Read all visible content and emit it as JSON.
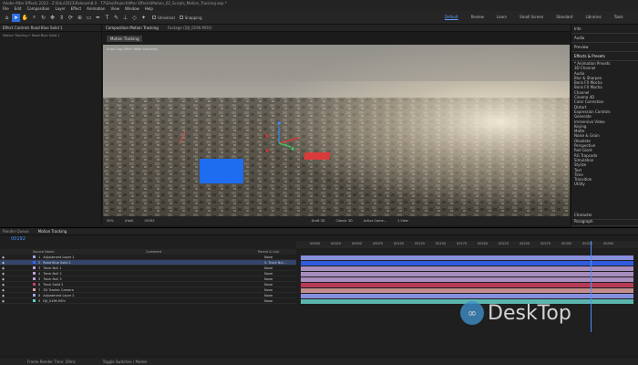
{
  "title_bar": "Adobe After Effects 2023 - Z:\\Edu\\2023\\Release\\8.0 - 77\\Edu\\Project\\After Effects\\Motion_02_Scripts_Motion_Tracking.aep *",
  "menu": [
    "File",
    "Edit",
    "Composition",
    "Layer",
    "Effect",
    "Animation",
    "View",
    "Window",
    "Help"
  ],
  "toolbar": {
    "universal_label": "Universal",
    "snapping_label": "Snapping",
    "workspaces": [
      "Default",
      "Review",
      "Learn",
      "Small Screen",
      "Standard",
      "Libraries",
      "Tools"
    ]
  },
  "project_panel": {
    "tab": "Effect Controls Road Blue Solid 1",
    "subtitle": "Motion Tracking • Road Blue Solid 1"
  },
  "composition": {
    "tab": "Composition Motion Tracking",
    "footage_tab": "Footage (DJI_0196.MOV)",
    "chip": "Motion Tracking",
    "overlay_text": "Auto Crop Effect Wide Smoothly",
    "bottom": {
      "zoom": "50%",
      "res": "(Half)",
      "timecode": "00192",
      "camera": "Classic 3D",
      "active_camera": "Active Came...",
      "views": "1 View",
      "draft": "Draft 3D"
    }
  },
  "right_panel": {
    "sections": [
      "Info",
      "Audio",
      "Preview",
      "Effects & Presets"
    ],
    "effects": [
      "* Animation Presets",
      "3D Channel",
      "Audio",
      "Blur & Sharpen",
      "Boris FX Mocha",
      "Boris FX Mocha",
      "Channel",
      "Cinema 4D",
      "Color Correction",
      "Distort",
      "Expression Controls",
      "Generate",
      "Immersive Video",
      "Keying",
      "Matte",
      "Noise & Grain",
      "Obsolete",
      "Perspective",
      "Red Giant",
      "RG Trapcode",
      "Simulation",
      "Stylize",
      "Text",
      "Time",
      "Transition",
      "Utility"
    ],
    "bottom_sections": [
      "Character",
      "Paragraph"
    ]
  },
  "timeline": {
    "tabs": [
      "Render Queue",
      "Motion Tracking"
    ],
    "timecode": "00192",
    "column_headers": [
      "Source Name",
      "Comment",
      "Parent & Link"
    ],
    "layers": [
      {
        "num": "1",
        "name": "Adjustment Layer 1",
        "color": "#9aa3ff",
        "parent": "None"
      },
      {
        "num": "2",
        "name": "Road Blue Solid 1",
        "color": "#3366ff",
        "parent": "5. Track Nul..."
      },
      {
        "num": "3",
        "name": "Track Null 1",
        "color": "#c0a0d8",
        "parent": "None"
      },
      {
        "num": "4",
        "name": "Track Null 2",
        "color": "#c0a0d8",
        "parent": "None"
      },
      {
        "num": "5",
        "name": "Track Null 3",
        "color": "#c0a0d8",
        "parent": "None"
      },
      {
        "num": "6",
        "name": "Track Solid 2",
        "color": "#d04060",
        "parent": "None"
      },
      {
        "num": "7",
        "name": "3D Tracker Camera",
        "color": "#e0a0a0",
        "parent": "None"
      },
      {
        "num": "8",
        "name": "Adjustment Layer 2",
        "color": "#9aa3ff",
        "parent": "None"
      },
      {
        "num": "9",
        "name": "DJI_0196.MOV",
        "color": "#66d0c8",
        "parent": "None"
      }
    ],
    "ruler_ticks": [
      "00000",
      "00025",
      "00050",
      "00075",
      "00100",
      "00125",
      "00150",
      "00175",
      "00200",
      "00225",
      "00250",
      "00275",
      "00300",
      "00325",
      "00350"
    ]
  },
  "status": {
    "frame_render": "Frame Render Time: 29ms",
    "toggle": "Toggle Switches / Modes"
  },
  "watermark": "DeskTop"
}
